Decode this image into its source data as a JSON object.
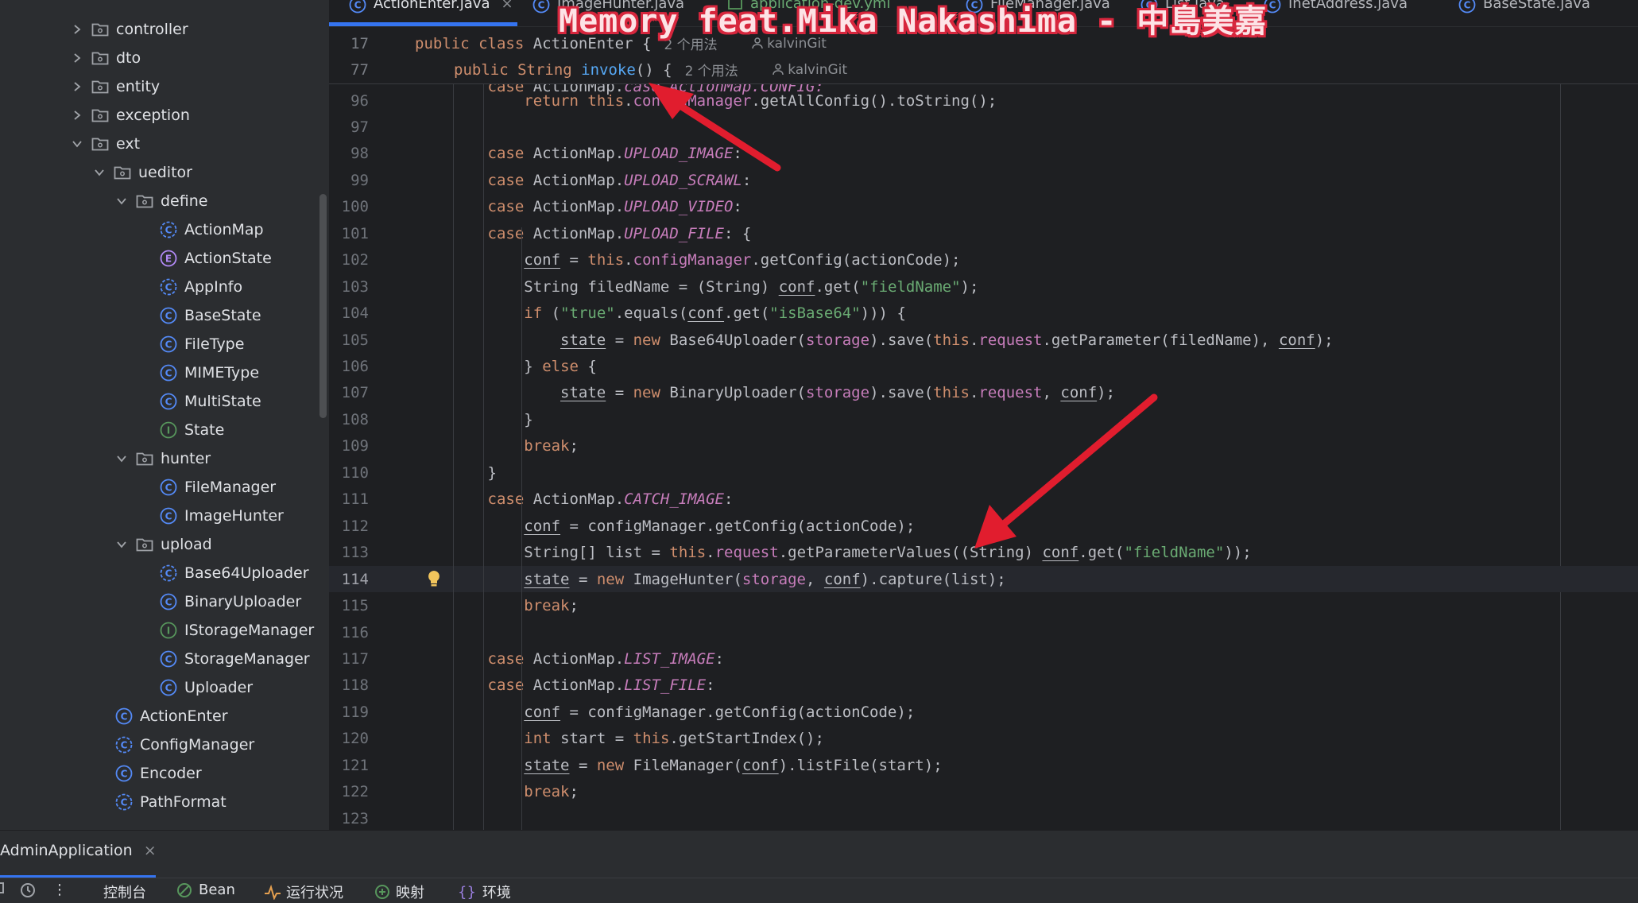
{
  "tree": {
    "items": [
      {
        "label": "controller",
        "type": "folder",
        "state": "collapsed"
      },
      {
        "label": "dto",
        "type": "folder",
        "state": "collapsed"
      },
      {
        "label": "entity",
        "type": "folder",
        "state": "collapsed"
      },
      {
        "label": "exception",
        "type": "folder",
        "state": "collapsed"
      },
      {
        "label": "ext",
        "type": "folder",
        "state": "expanded"
      },
      {
        "label": "ueditor",
        "type": "folder",
        "state": "expanded"
      },
      {
        "label": "define",
        "type": "folder",
        "state": "expanded"
      },
      {
        "label": "ActionMap",
        "type": "class-c"
      },
      {
        "label": "ActionState",
        "type": "enum"
      },
      {
        "label": "AppInfo",
        "type": "class-c"
      },
      {
        "label": "BaseState",
        "type": "class"
      },
      {
        "label": "FileType",
        "type": "class"
      },
      {
        "label": "MIMEType",
        "type": "class"
      },
      {
        "label": "MultiState",
        "type": "class"
      },
      {
        "label": "State",
        "type": "interface"
      },
      {
        "label": "hunter",
        "type": "folder",
        "state": "expanded"
      },
      {
        "label": "FileManager",
        "type": "class"
      },
      {
        "label": "ImageHunter",
        "type": "class"
      },
      {
        "label": "upload",
        "type": "folder",
        "state": "expanded"
      },
      {
        "label": "Base64Uploader",
        "type": "class-c"
      },
      {
        "label": "BinaryUploader",
        "type": "class"
      },
      {
        "label": "IStorageManager",
        "type": "interface"
      },
      {
        "label": "StorageManager",
        "type": "class"
      },
      {
        "label": "Uploader",
        "type": "class"
      },
      {
        "label": "ActionEnter",
        "type": "class"
      },
      {
        "label": "ConfigManager",
        "type": "class-c"
      },
      {
        "label": "Encoder",
        "type": "class"
      },
      {
        "label": "PathFormat",
        "type": "class-c"
      }
    ]
  },
  "tabs": [
    {
      "label": "ActionEnter.java",
      "active": true,
      "close": "×"
    },
    {
      "label": "ImageHunter.java"
    },
    {
      "label": "application-dev.yml"
    },
    {
      "label": "FileManager.java"
    },
    {
      "label": "List.java"
    },
    {
      "label": "InetAddress.java"
    },
    {
      "label": "BaseState.java"
    }
  ],
  "sticky": {
    "line1_num": "17",
    "line1_code": "public class ActionEnter {",
    "line1_usages": "2 个用法",
    "line1_author": "kalvinGit",
    "line2_num": "77",
    "line2_code_pre": "public String ",
    "line2_method": "invoke",
    "line2_code_post": "() {",
    "line2_usages": "2 个用法",
    "line2_author": "kalvinGit",
    "partial_line": "case ActionMap.CONFIG:"
  },
  "code": {
    "first_line_number": 96,
    "current_line": 114,
    "lines": [
      "            return this.configManager.getAllConfig().toString();",
      "",
      "        case ActionMap.UPLOAD_IMAGE:",
      "        case ActionMap.UPLOAD_SCRAWL:",
      "        case ActionMap.UPLOAD_VIDEO:",
      "        case ActionMap.UPLOAD_FILE: {",
      "            conf = this.configManager.getConfig(actionCode);",
      "            String filedName = (String) conf.get(\"fieldName\");",
      "            if (\"true\".equals(conf.get(\"isBase64\"))) {",
      "                state = new Base64Uploader(storage).save(this.request.getParameter(filedName), conf);",
      "            } else {",
      "                state = new BinaryUploader(storage).save(this.request, conf);",
      "            }",
      "            break;",
      "        }",
      "        case ActionMap.CATCH_IMAGE:",
      "            conf = configManager.getConfig(actionCode);",
      "            String[] list = this.request.getParameterValues((String) conf.get(\"fieldName\"));",
      "            state = new ImageHunter(storage, conf).capture(list);",
      "            break;",
      "",
      "        case ActionMap.LIST_IMAGE:",
      "        case ActionMap.LIST_FILE:",
      "            conf = configManager.getConfig(actionCode);",
      "            int start = this.getStartIndex();",
      "            state = new FileManager(conf).listFile(start);",
      "            break;",
      ""
    ]
  },
  "bottom": {
    "run_tab": "AdminApplication",
    "run_close": "×",
    "tools": [
      "控制台",
      "Bean",
      "运行状况",
      "映射",
      "环境"
    ]
  },
  "overlay": {
    "title": "Memory feat.Mika Nakashima - 中島美嘉"
  },
  "colors": {
    "keyword": "#cf8e6d",
    "field": "#c77dbb",
    "string": "#6aab73",
    "method": "#56a8f5",
    "accent": "#3574f0",
    "arrow": "#e11d2e"
  }
}
